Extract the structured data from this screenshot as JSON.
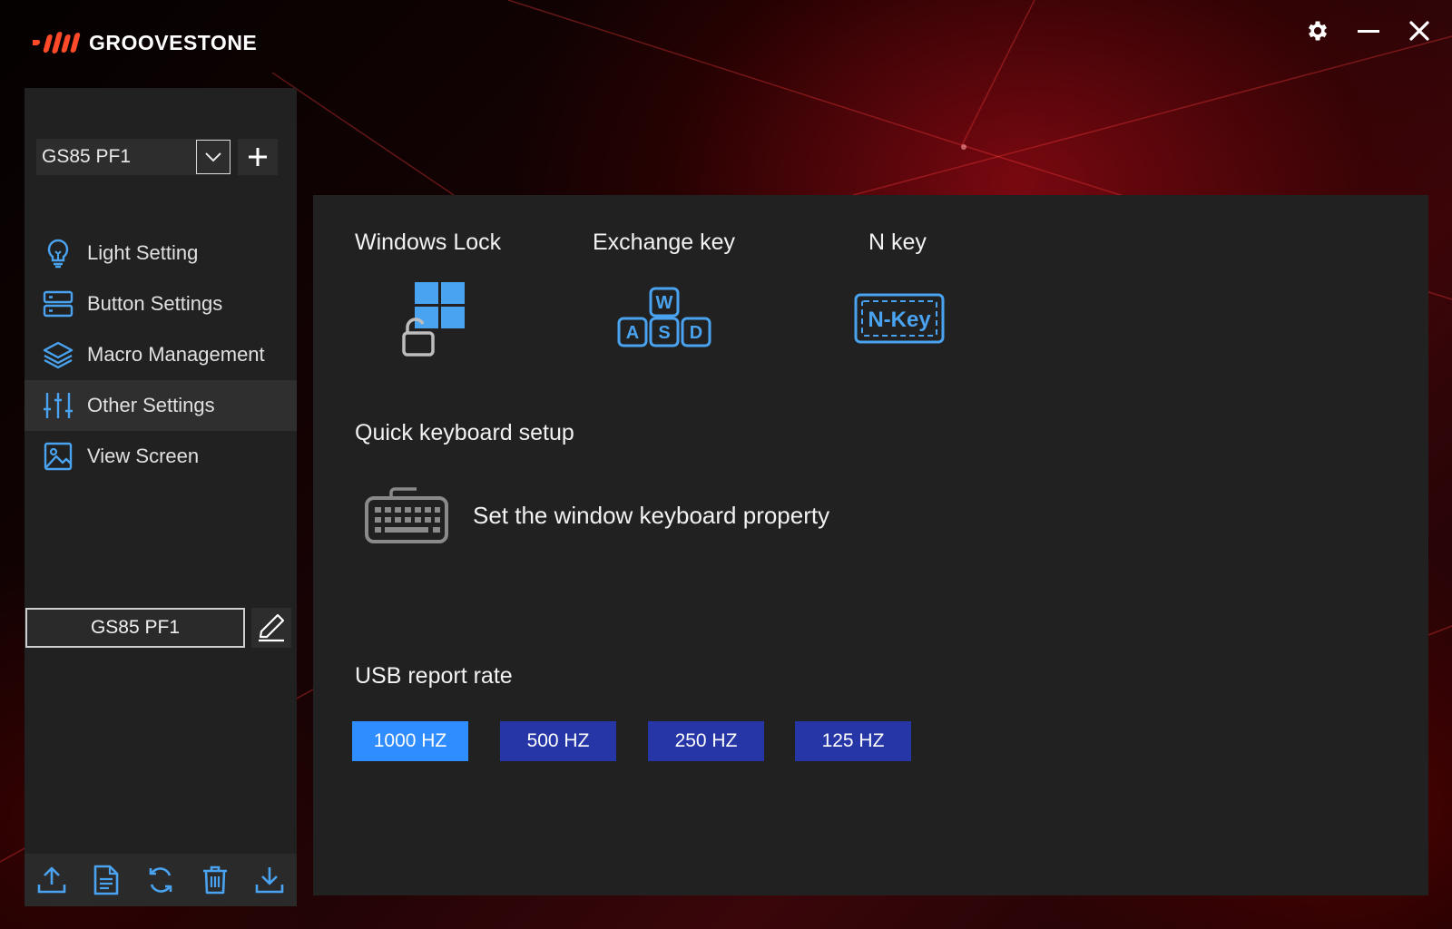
{
  "brand": {
    "name": "GROOVESTONE",
    "accent": "#ff4a2a"
  },
  "window_controls": {
    "settings_icon": "gear-icon",
    "minimize_icon": "minimize-icon",
    "close_icon": "close-icon"
  },
  "sidebar": {
    "profile_select": {
      "value": "GS85 PF1"
    },
    "nav": [
      {
        "label": "Light Setting",
        "icon": "lightbulb-icon",
        "active": false
      },
      {
        "label": "Button Settings",
        "icon": "buttons-icon",
        "active": false
      },
      {
        "label": "Macro Management",
        "icon": "layers-icon",
        "active": false
      },
      {
        "label": "Other Settings",
        "icon": "sliders-icon",
        "active": true
      },
      {
        "label": "View Screen",
        "icon": "image-icon",
        "active": false
      }
    ],
    "profile_name": "GS85 PF1",
    "footer_icons": [
      "upload-icon",
      "file-icon",
      "refresh-icon",
      "trash-icon",
      "download-icon"
    ]
  },
  "main": {
    "features": [
      {
        "title": "Windows Lock",
        "icon": "windows-lock-icon"
      },
      {
        "title": "Exchange key",
        "icon": "wasd-keys-icon"
      },
      {
        "title": "N key",
        "icon": "n-key-icon"
      }
    ],
    "n_key_badge": "N-Key",
    "wasd": {
      "top": "W",
      "left": "A",
      "mid": "S",
      "right": "D"
    },
    "quick_setup": {
      "title": "Quick keyboard setup",
      "text": "Set the window keyboard property",
      "icon": "keyboard-icon"
    },
    "usb_rate": {
      "title": "USB report rate",
      "options": [
        "1000 HZ",
        "500 HZ",
        "250 HZ",
        "125 HZ"
      ],
      "selected": "1000 HZ"
    }
  },
  "colors": {
    "selected_rate": "#2f8dff",
    "rate_button": "#2636a6",
    "icon_blue": "#4aa3f0",
    "panel": "#212121"
  }
}
